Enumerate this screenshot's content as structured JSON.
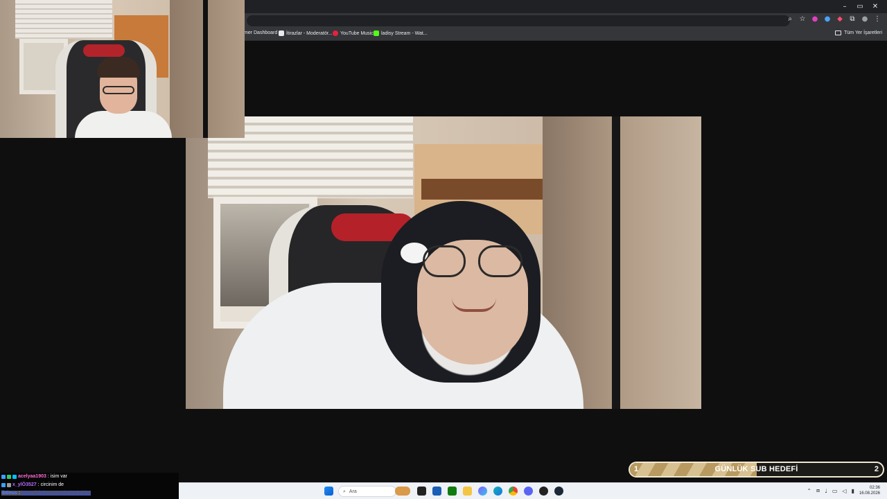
{
  "browser": {
    "window_controls": {
      "minimize": "–",
      "maximize": "▭",
      "close": "✕"
    },
    "bookmarks": [
      {
        "label": "mer Dashboard",
        "icon": "page-icon",
        "color": "#e8eaed"
      },
      {
        "label": "İtirazlar - Moderatör...",
        "icon": "document-icon",
        "color": "#e8eaed"
      },
      {
        "label": "YouTube Music",
        "icon": "youtube-music-icon",
        "color": "#e5223f"
      },
      {
        "label": "ladisy Stream - Wat...",
        "icon": "kick-icon",
        "color": "#53fc18"
      }
    ],
    "all_bookmarks_label": "Tüm Yer İşaretleri"
  },
  "sub_goal": {
    "current": "1",
    "title": "GÜNLÜK SUB HEDEFİ",
    "target": "2",
    "progress": 0.5
  },
  "chat": {
    "messages": [
      {
        "user": "acelyaa1903",
        "separator": ":",
        "text": "isim var",
        "user_color": "#ff6ad5"
      },
      {
        "user": "x_ylÖ3527",
        "separator": ":",
        "text": "circinim de",
        "user_color": "#b76bff"
      },
      {
        "user": "ibtinus",
        "separator": ":",
        "text": "https://i.ibtinus.com/tmk9nbrl.jpg",
        "user_color": "#5b7bff"
      }
    ]
  },
  "taskbar": {
    "search_placeholder": "Ara",
    "clock_time": "02:36",
    "clock_date": "16.08.2026"
  }
}
